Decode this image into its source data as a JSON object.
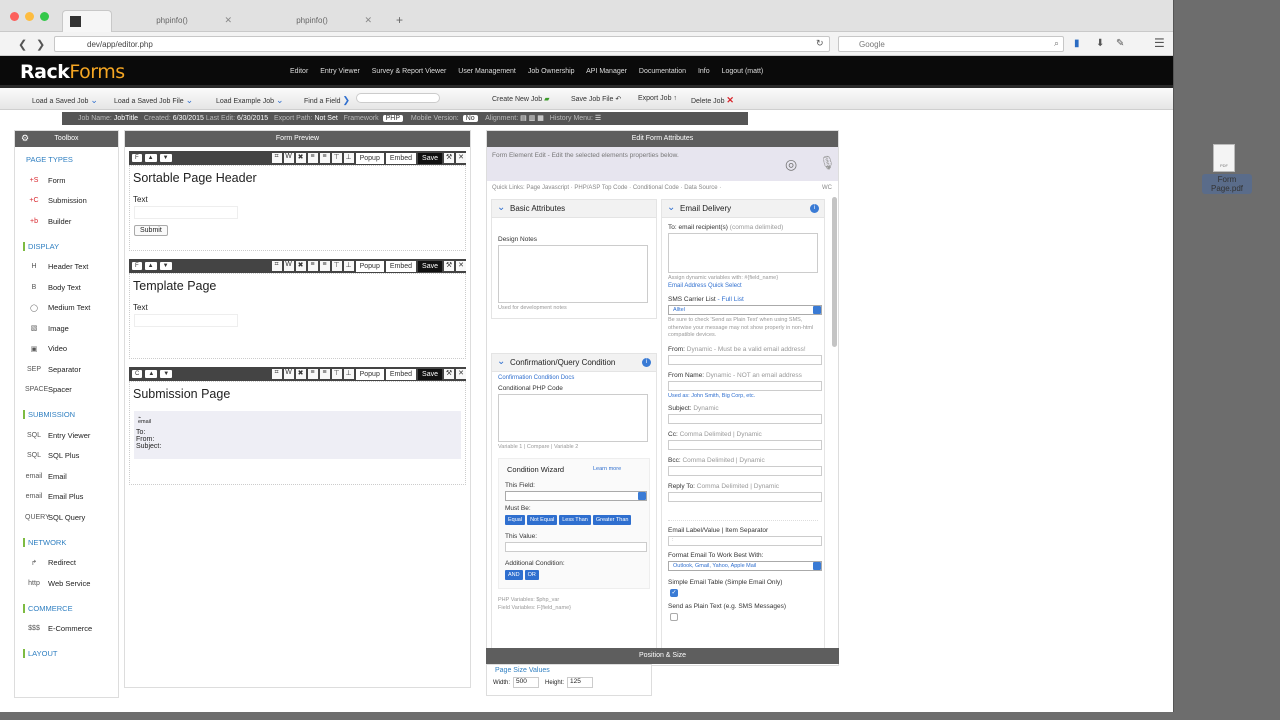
{
  "browser": {
    "tabs": [
      {
        "label": "phpinfo()"
      },
      {
        "label": "phpinfo()"
      }
    ],
    "url": "dev/app/editor.php",
    "search_placeholder": "Google"
  },
  "desktop": {
    "file_label": "Form Page.pdf",
    "file_badge": "PDF"
  },
  "app": {
    "logo_main": "Rack",
    "logo_accent": "Forms",
    "nav": [
      "Editor",
      "Entry Viewer",
      "Survey & Report Viewer",
      "User Management",
      "Job Ownership",
      "API Manager",
      "Documentation",
      "Info",
      "Logout (matt)"
    ]
  },
  "jobbar": {
    "load_saved_job": "Load a Saved Job",
    "load_saved_job_file": "Load a Saved Job File",
    "load_example_job": "Load Example Job",
    "find_field": "Find a Field",
    "create_new_job": "Create New Job",
    "save_job_file": "Save Job File",
    "export_job": "Export Job",
    "delete_job": "Delete Job"
  },
  "infobar": {
    "job_name_label": "Job Name:",
    "job_name": "JobTitle",
    "created_label": "Created:",
    "created": "6/30/2015",
    "last_edit_label": "Last Edit:",
    "last_edit": "6/30/2015",
    "export_path_label": "Export Path:",
    "export_path": "Not Set",
    "framework_label": "Framework",
    "framework": "PHP",
    "mobile_label": "Mobile Version:",
    "mobile": "No",
    "alignment_label": "Alignment:",
    "history_label": "History Menu:"
  },
  "toolbox": {
    "title": "Toolbox",
    "sections": [
      {
        "title": "PAGE TYPES",
        "items": [
          {
            "icon": "+S",
            "label": "Form"
          },
          {
            "icon": "+C",
            "label": "Submission"
          },
          {
            "icon": "+b",
            "label": "Builder"
          }
        ]
      },
      {
        "title": "DISPLAY",
        "items": [
          {
            "icon": "H",
            "label": "Header Text"
          },
          {
            "icon": "B",
            "label": "Body Text"
          },
          {
            "icon": "◯",
            "label": "Medium Text"
          },
          {
            "icon": "▧",
            "label": "Image"
          },
          {
            "icon": "▣",
            "label": "Video"
          },
          {
            "icon": "SEP",
            "label": "Separator"
          },
          {
            "icon": "SPACE",
            "label": "Spacer"
          }
        ]
      },
      {
        "title": "SUBMISSION",
        "items": [
          {
            "icon": "SQL",
            "label": "Entry Viewer"
          },
          {
            "icon": "SQL",
            "label": "SQL Plus"
          },
          {
            "icon": "email",
            "label": "Email"
          },
          {
            "icon": "email",
            "label": "Email Plus"
          },
          {
            "icon": "QUERY",
            "label": "SQL Query"
          }
        ]
      },
      {
        "title": "NETWORK",
        "items": [
          {
            "icon": "↱",
            "label": "Redirect"
          },
          {
            "icon": "http",
            "label": "Web Service"
          }
        ]
      },
      {
        "title": "COMMERCE",
        "items": [
          {
            "icon": "$$$",
            "label": "E-Commerce"
          }
        ]
      },
      {
        "title": "LAYOUT",
        "items": []
      }
    ]
  },
  "preview": {
    "title": "Form Preview",
    "toolbar": {
      "popup": "Popup",
      "embed": "Embed",
      "save": "Save"
    },
    "pages": [
      {
        "badge": "F",
        "title": "Sortable Page Header",
        "text": "Text",
        "submit": "Submit"
      },
      {
        "badge": "F",
        "title": "Template Page",
        "text": "Text"
      },
      {
        "badge": "C",
        "title": "Submission Page",
        "email_caption": "email",
        "to": "To:",
        "from": "From:",
        "subject": "Subject:"
      }
    ]
  },
  "edit": {
    "title": "Edit Form Attributes",
    "subtitle": "Form Element Edit - Edit the selected elements properties below.",
    "quick_links": "Quick Links: Page Javascript  ·  PHP/ASP Top Code  ·  Conditional Code  ·  Data Source  ·",
    "wc": "WC",
    "basic": {
      "title": "Basic Attributes",
      "design_notes": "Design Notes",
      "design_hint": "Used for development notes"
    },
    "condition": {
      "title": "Confirmation/Query Condition",
      "docs": "Confirmation Condition Docs",
      "php_code": "Conditional PHP Code",
      "hint": "Variable 1 | Compare | Variable 2",
      "wizard": "Condition Wizard",
      "learn_more": "Learn more",
      "this_field": "This Field:",
      "must_be": "Must Be:",
      "ops": [
        "Equal",
        "Not Equal",
        "Less Than",
        "Greater Than"
      ],
      "this_value": "This Value:",
      "additional": "Additional Condition:",
      "and": "AND",
      "or": "OR",
      "php_vars": "PHP Variables: $php_var",
      "field_vars": "Field Variables: F{field_name}"
    },
    "email": {
      "title": "Email Delivery",
      "to_label": "To: email recipient(s)",
      "to_hint": "(comma delimited)",
      "assign_hint": "Assign dynamic variables with: #{field_name}",
      "quick_select": "Email Address Quick Select",
      "sms_label": "SMS Carrier List",
      "sms_link": "- Full List",
      "sms_value": "Alltel",
      "sms_hint": "Be sure to check 'Send as Plain Text' when using SMS, otherwise your message may not show properly in non-html compatible devices.",
      "from_label": "From:",
      "from_hint": "Dynamic - Must be a valid email address!",
      "from_name_label": "From Name:",
      "from_name_hint": "Dynamic - NOT an email address",
      "used_as": "Used as: John Smith, Big Corp, etc.",
      "subject_label": "Subject:",
      "subject_hint": "Dynamic",
      "cc_label": "Cc:",
      "cc_hint": "Comma Delimited | Dynamic",
      "bcc_label": "Bcc:",
      "bcc_hint": "Comma Delimited | Dynamic",
      "reply_label": "Reply To:",
      "reply_hint": "Comma Delimited | Dynamic",
      "separator_label": "Email Label/Value | Item Separator",
      "separator_value": ":",
      "format_label": "Format Email To Work Best With:",
      "format_value": "Outlook, Gmail, Yahoo, Apple Mail",
      "simple_table": "Simple Email Table (Simple Email Only)",
      "plain_text": "Send as Plain Text (e.g. SMS Messages)"
    }
  },
  "position": {
    "title": "Position & Size",
    "page_size": "Page Size Values",
    "width_label": "Width:",
    "width": "500",
    "height_label": "Height:",
    "height": "125"
  }
}
